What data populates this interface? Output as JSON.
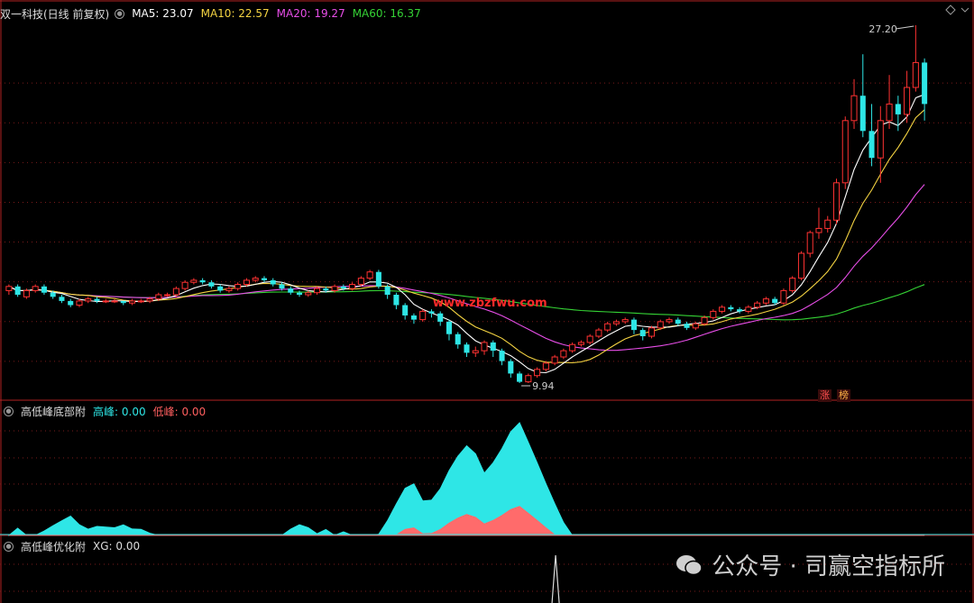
{
  "main": {
    "title": "双一科技(日线 前复权)",
    "indicators": [
      {
        "label": "MA5: 23.07",
        "color": "#ffffff"
      },
      {
        "label": "MA10: 22.57",
        "color": "#f5d442"
      },
      {
        "label": "MA20: 19.27",
        "color": "#e84ee8"
      },
      {
        "label": "MA60: 16.37",
        "color": "#35d335"
      }
    ],
    "high_label": "27.20",
    "low_label": "9.94",
    "badges": [
      "涨",
      "榜"
    ],
    "watermark_overlay": "www.zbzfwu.com"
  },
  "sub1": {
    "title": "高低峰底部附",
    "items": [
      {
        "label": "高峰: 0.00",
        "color": "#2ee6e6"
      },
      {
        "label": "低峰: 0.00",
        "color": "#ff5f5f"
      }
    ]
  },
  "sub2": {
    "title": "高低峰优化附",
    "items": [
      {
        "label": "XG: 0.00",
        "color": "#dddddd"
      }
    ]
  },
  "watermark": {
    "text": "公众号 · 司赢空指标所"
  },
  "chart_data": {
    "type": "candlestick",
    "ylim": [
      9.94,
      27.2
    ],
    "candles": [
      [
        14.4,
        14.6,
        14.7,
        14.2
      ],
      [
        14.6,
        14.2,
        14.7,
        14.1
      ],
      [
        14.1,
        14.4,
        14.5,
        14.0
      ],
      [
        14.4,
        14.6,
        14.7,
        14.3
      ],
      [
        14.6,
        14.3,
        14.7,
        14.2
      ],
      [
        14.3,
        14.1,
        14.4,
        14.0
      ],
      [
        14.1,
        13.9,
        14.2,
        13.8
      ],
      [
        13.9,
        13.7,
        14.0,
        13.6
      ],
      [
        13.7,
        13.9,
        14.0,
        13.6
      ],
      [
        13.9,
        14.0,
        14.1,
        13.8
      ],
      [
        14.0,
        13.9,
        14.1,
        13.8
      ],
      [
        13.9,
        13.9,
        14.0,
        13.8
      ],
      [
        13.9,
        13.9,
        14.0,
        13.8
      ],
      [
        13.9,
        13.8,
        13.9,
        13.7
      ],
      [
        13.8,
        13.9,
        14.0,
        13.7
      ],
      [
        13.9,
        13.9,
        14.0,
        13.8
      ],
      [
        13.9,
        14.0,
        14.1,
        13.8
      ],
      [
        14.0,
        14.2,
        14.3,
        13.9
      ],
      [
        14.2,
        14.2,
        14.3,
        14.1
      ],
      [
        14.2,
        14.5,
        14.6,
        14.1
      ],
      [
        14.5,
        14.8,
        14.9,
        14.4
      ],
      [
        14.8,
        14.9,
        15.0,
        14.7
      ],
      [
        14.9,
        14.8,
        15.0,
        14.7
      ],
      [
        14.8,
        14.6,
        14.9,
        14.5
      ],
      [
        14.6,
        14.4,
        14.7,
        14.3
      ],
      [
        14.4,
        14.5,
        14.6,
        14.3
      ],
      [
        14.5,
        14.7,
        14.8,
        14.4
      ],
      [
        14.7,
        14.9,
        15.0,
        14.6
      ],
      [
        14.9,
        15.0,
        15.1,
        14.8
      ],
      [
        15.0,
        14.9,
        15.1,
        14.8
      ],
      [
        14.9,
        14.7,
        15.0,
        14.6
      ],
      [
        14.7,
        14.5,
        14.8,
        14.4
      ],
      [
        14.5,
        14.3,
        14.6,
        14.2
      ],
      [
        14.3,
        14.2,
        14.4,
        14.1
      ],
      [
        14.2,
        14.3,
        14.4,
        14.1
      ],
      [
        14.3,
        14.5,
        14.6,
        14.2
      ],
      [
        14.5,
        14.4,
        14.6,
        14.3
      ],
      [
        14.4,
        14.6,
        14.7,
        14.3
      ],
      [
        14.6,
        14.5,
        14.7,
        14.4
      ],
      [
        14.5,
        14.7,
        14.8,
        14.4
      ],
      [
        14.7,
        15.0,
        15.1,
        14.6
      ],
      [
        15.0,
        15.3,
        15.4,
        14.9
      ],
      [
        15.3,
        14.6,
        15.4,
        14.5
      ],
      [
        14.6,
        14.2,
        14.7,
        14.0
      ],
      [
        14.2,
        13.7,
        14.3,
        13.5
      ],
      [
        13.7,
        13.2,
        13.8,
        13.0
      ],
      [
        13.2,
        13.0,
        13.3,
        12.8
      ],
      [
        13.0,
        13.4,
        13.5,
        12.9
      ],
      [
        13.4,
        13.3,
        13.5,
        13.1
      ],
      [
        13.3,
        12.9,
        13.4,
        12.7
      ],
      [
        12.9,
        12.3,
        13.0,
        12.0
      ],
      [
        12.3,
        11.8,
        12.4,
        11.6
      ],
      [
        11.8,
        11.4,
        11.9,
        11.2
      ],
      [
        11.4,
        11.5,
        11.7,
        11.2
      ],
      [
        11.5,
        11.9,
        12.0,
        11.3
      ],
      [
        11.9,
        11.5,
        12.0,
        11.2
      ],
      [
        11.5,
        11.0,
        11.6,
        10.8
      ],
      [
        11.0,
        10.4,
        11.1,
        10.2
      ],
      [
        10.4,
        10.0,
        10.5,
        9.94
      ],
      [
        10.0,
        10.3,
        10.4,
        9.94
      ],
      [
        10.3,
        10.6,
        10.7,
        10.2
      ],
      [
        10.6,
        10.9,
        11.0,
        10.5
      ],
      [
        10.9,
        11.2,
        11.3,
        10.8
      ],
      [
        11.2,
        11.5,
        11.6,
        11.1
      ],
      [
        11.5,
        11.8,
        11.9,
        11.4
      ],
      [
        11.8,
        11.9,
        12.0,
        11.7
      ],
      [
        11.9,
        12.2,
        12.3,
        11.8
      ],
      [
        12.2,
        12.5,
        12.6,
        12.1
      ],
      [
        12.5,
        12.8,
        12.9,
        12.4
      ],
      [
        12.8,
        12.9,
        13.0,
        12.7
      ],
      [
        12.9,
        13.0,
        13.1,
        12.8
      ],
      [
        13.0,
        12.5,
        13.1,
        12.3
      ],
      [
        12.5,
        12.2,
        12.6,
        12.0
      ],
      [
        12.2,
        12.6,
        12.7,
        12.1
      ],
      [
        12.6,
        12.9,
        13.0,
        12.5
      ],
      [
        12.9,
        13.0,
        13.1,
        12.8
      ],
      [
        13.0,
        12.8,
        13.1,
        12.7
      ],
      [
        12.8,
        12.6,
        12.9,
        12.5
      ],
      [
        12.6,
        12.8,
        12.9,
        12.5
      ],
      [
        12.8,
        13.1,
        13.2,
        12.7
      ],
      [
        13.1,
        13.4,
        13.5,
        13.0
      ],
      [
        13.4,
        13.6,
        13.7,
        13.3
      ],
      [
        13.6,
        13.5,
        13.7,
        13.4
      ],
      [
        13.5,
        13.4,
        13.6,
        13.3
      ],
      [
        13.4,
        13.6,
        13.7,
        13.3
      ],
      [
        13.6,
        13.8,
        13.9,
        13.5
      ],
      [
        13.8,
        14.0,
        14.1,
        13.7
      ],
      [
        14.0,
        13.8,
        14.1,
        13.7
      ],
      [
        13.8,
        14.4,
        14.5,
        13.7
      ],
      [
        14.4,
        15.0,
        15.1,
        14.3
      ],
      [
        15.0,
        16.2,
        16.3,
        14.9
      ],
      [
        16.2,
        17.2,
        17.3,
        16.0
      ],
      [
        17.2,
        17.4,
        18.4,
        16.9
      ],
      [
        17.4,
        17.8,
        18.0,
        17.2
      ],
      [
        17.8,
        19.6,
        19.8,
        17.6
      ],
      [
        19.6,
        22.6,
        22.8,
        19.3
      ],
      [
        22.6,
        23.8,
        24.6,
        22.2
      ],
      [
        23.8,
        22.1,
        25.8,
        21.8
      ],
      [
        22.1,
        20.8,
        23.4,
        20.4
      ],
      [
        20.8,
        22.6,
        23.3,
        19.6
      ],
      [
        22.6,
        23.4,
        24.8,
        22.2
      ],
      [
        23.4,
        22.9,
        23.8,
        22.1
      ],
      [
        22.9,
        24.2,
        25.0,
        22.5
      ],
      [
        24.2,
        25.4,
        27.2,
        24.0
      ],
      [
        25.4,
        23.4,
        25.6,
        22.6
      ]
    ],
    "xg_series": [
      0,
      0,
      0,
      0,
      0,
      0,
      0,
      0,
      0,
      0,
      0,
      0,
      0,
      0,
      0,
      0,
      0,
      0,
      0,
      0,
      0,
      0,
      0,
      0,
      0,
      0,
      0,
      0,
      0,
      0,
      0,
      0,
      0,
      0,
      0,
      0,
      0,
      0,
      0,
      0,
      0,
      0,
      0,
      0,
      0,
      0,
      0,
      0,
      0,
      0,
      0,
      0,
      0,
      0,
      0,
      0,
      0,
      0,
      1,
      0,
      0,
      0,
      0,
      0,
      0,
      0,
      0,
      0,
      0,
      0,
      0,
      0,
      0,
      0,
      0,
      0,
      0,
      0,
      0,
      0,
      0,
      0,
      0,
      0,
      0,
      0,
      0,
      0,
      0,
      0,
      0,
      0,
      0,
      0,
      0,
      0,
      0,
      0,
      0,
      0,
      0,
      0,
      0,
      0,
      0
    ]
  }
}
